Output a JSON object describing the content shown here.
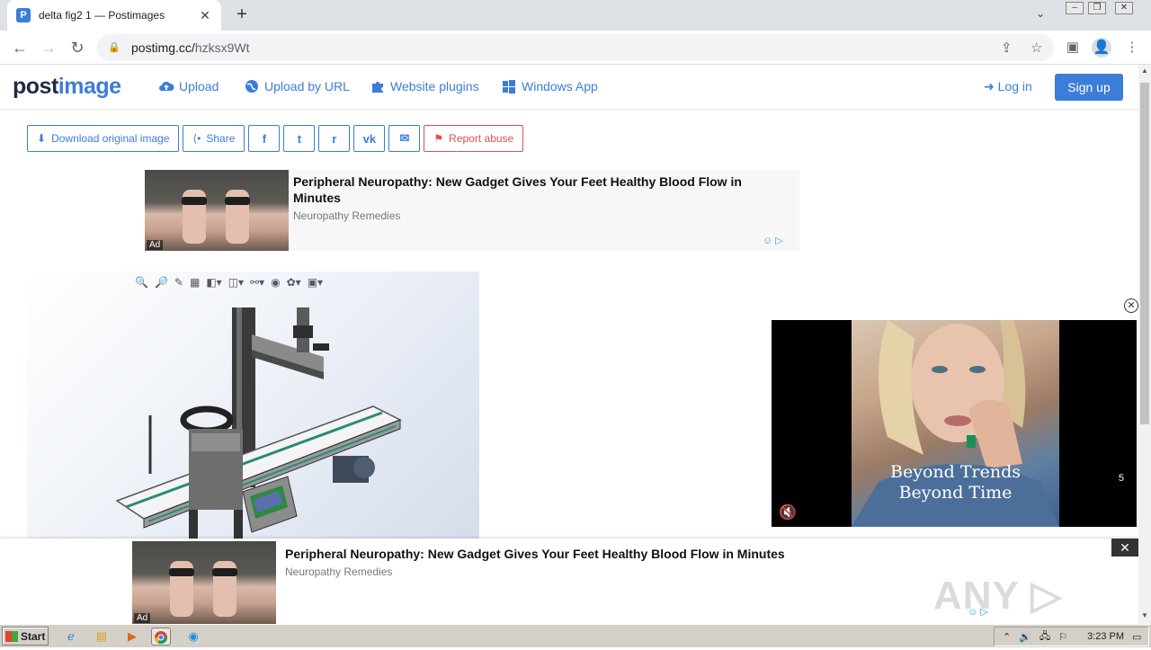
{
  "browser": {
    "tab_title": "delta fig2 1 — Postimages",
    "tab_close": "✕",
    "new_tab": "+",
    "url_host": "postimg.cc/",
    "url_path": "hzksx9Wt"
  },
  "site": {
    "logo_a": "post",
    "logo_b": "image",
    "nav": [
      {
        "label": "Upload",
        "icon": "cloud-upload-icon"
      },
      {
        "label": "Upload by URL",
        "icon": "globe-icon"
      },
      {
        "label": "Website plugins",
        "icon": "puzzle-icon"
      },
      {
        "label": "Windows App",
        "icon": "windows-icon"
      }
    ],
    "login": "Log in",
    "signup": "Sign up"
  },
  "actions": {
    "download": "Download original image",
    "share": "Share",
    "facebook": "f",
    "twitter": "t",
    "reddit": "r",
    "vk": "vk",
    "email": "✉",
    "report": "Report abuse"
  },
  "ads": {
    "top": {
      "title": "Peripheral Neuropathy: New Gadget Gives Your Feet Healthy Blood Flow in Minutes",
      "source": "Neuropathy Remedies",
      "tag": "Ad"
    },
    "video": {
      "line1": "Beyond Trends",
      "line2": "Beyond Time",
      "countdown": "5"
    },
    "bottom": {
      "title": "Peripheral Neuropathy: New Gadget Gives Your Feet Healthy Blood Flow in Minutes",
      "source": "Neuropathy Remedies",
      "tag": "Ad",
      "close": "✕"
    }
  },
  "watermark": "ANY ▷ RUN",
  "taskbar": {
    "start": "Start",
    "time": "3:23 PM"
  }
}
